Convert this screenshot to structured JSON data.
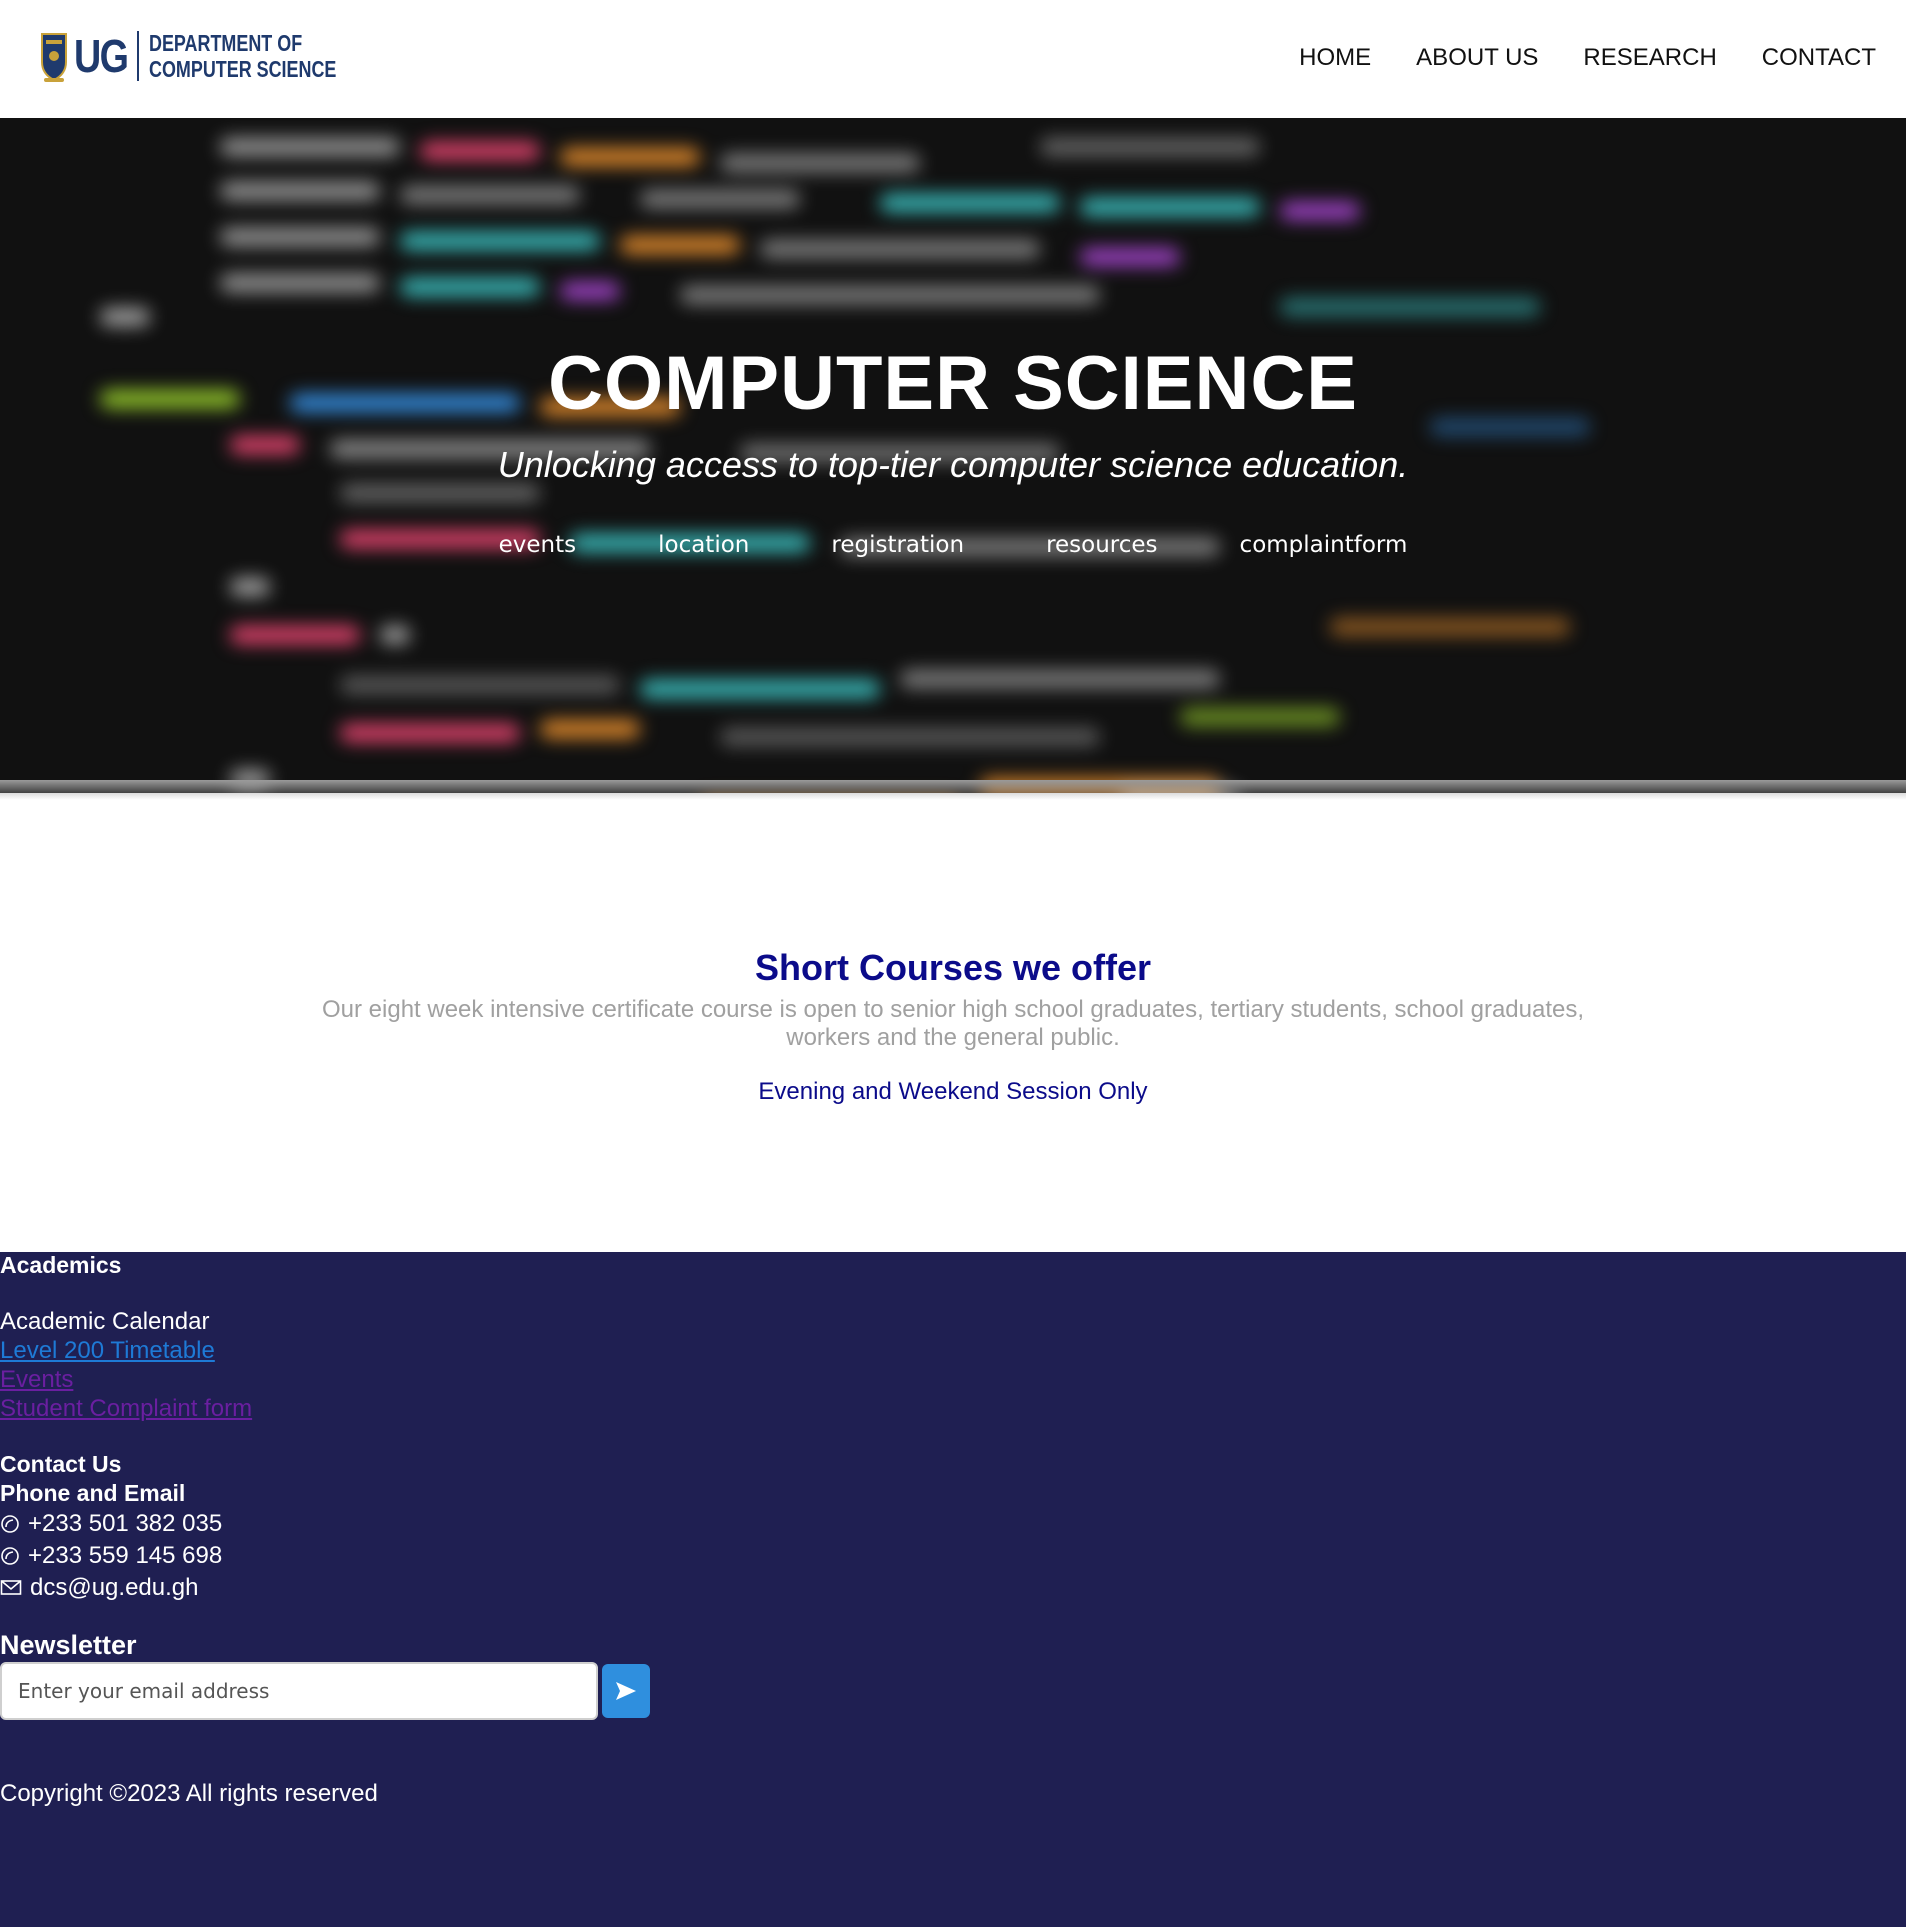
{
  "header": {
    "logo_ug": "UG",
    "logo_line1": "DEPARTMENT OF",
    "logo_line2": "COMPUTER SCIENCE",
    "nav": [
      "HOME",
      "ABOUT US",
      "RESEARCH",
      "CONTACT"
    ]
  },
  "hero": {
    "title": "COMPUTER SCIENCE",
    "subtitle": "Unlocking access to top-tier computer science education.",
    "links": [
      "events",
      "location",
      "registration",
      "resources",
      "complaintform"
    ]
  },
  "courses": {
    "title": "Short Courses we offer",
    "description": "Our eight week intensive certificate course is open to senior high school graduates, tertiary students, school graduates, workers and the general public.",
    "session": "Evening and Weekend Session Only"
  },
  "footer": {
    "academics_heading": "Academics",
    "academic_calendar": "Academic Calendar",
    "links": [
      "Level 200 Timetable",
      "Events",
      "Student Complaint form"
    ],
    "contact_heading": "Contact Us",
    "phone_email_heading": "Phone and Email",
    "phones": [
      "+233 501 382 035",
      "+233 559 145 698"
    ],
    "email": "dcs@ug.edu.gh",
    "newsletter_heading": "Newsletter",
    "newsletter_placeholder": "Enter your email address",
    "copyright": "Copyright ©2023 All rights reserved"
  },
  "colors": {
    "brand_navy": "#1f3a6d",
    "footer_bg": "#1f1f52",
    "heading_blue": "#0b0b8a",
    "link_blue": "#1e7ad6",
    "link_visited": "#6a1fa0",
    "send_button": "#2f8fde"
  },
  "icons": {
    "phone": "phone-icon",
    "email": "mail-icon",
    "send": "send-arrow-icon"
  }
}
